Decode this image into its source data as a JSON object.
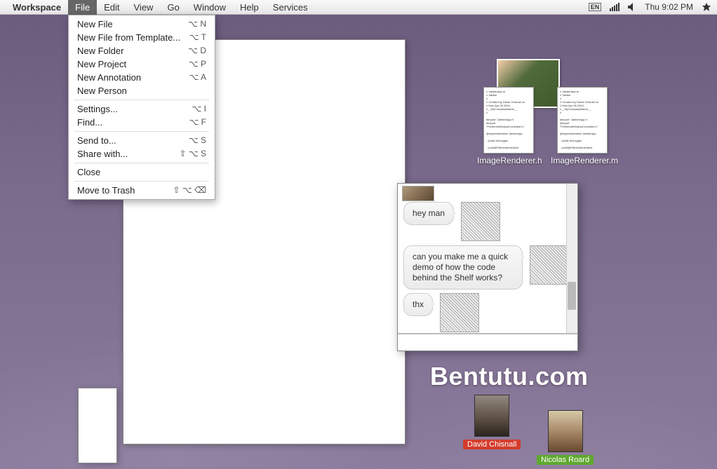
{
  "menubar": {
    "items": [
      {
        "label": "Workspace",
        "bold": true
      },
      {
        "label": "File",
        "active": true
      },
      {
        "label": "Edit"
      },
      {
        "label": "View"
      },
      {
        "label": "Go"
      },
      {
        "label": "Window"
      },
      {
        "label": "Help"
      },
      {
        "label": "Services"
      }
    ],
    "right": {
      "lang": "EN",
      "clock": "Thu 9:02 PM"
    }
  },
  "file_menu": {
    "groups": [
      [
        {
          "label": "New File",
          "shortcut": "⌥ N"
        },
        {
          "label": "New File from Template...",
          "shortcut": "⌥ T"
        },
        {
          "label": "New Folder",
          "shortcut": "⌥ D"
        },
        {
          "label": "New Project",
          "shortcut": "⌥ P"
        },
        {
          "label": "New Annotation",
          "shortcut": "⌥ A"
        },
        {
          "label": "New Person",
          "shortcut": ""
        }
      ],
      [
        {
          "label": "Settings...",
          "shortcut": "⌥ I"
        },
        {
          "label": "Find...",
          "shortcut": "⌥ F"
        }
      ],
      [
        {
          "label": "Send to...",
          "shortcut": "⌥ S"
        },
        {
          "label": "Share with...",
          "shortcut": "⇧ ⌥ S"
        }
      ],
      [
        {
          "label": "Close",
          "shortcut": ""
        }
      ],
      [
        {
          "label": "Move to Trash",
          "shortcut": "⇧ ⌥ ⌫"
        }
      ]
    ]
  },
  "desktop_files": {
    "file1": "ImageRenderer.h",
    "file2": "ImageRenderer.m"
  },
  "chat": {
    "messages": [
      {
        "text": "hey man"
      },
      {
        "text": "can you make me a quick demo of how the code behind the Shelf works?"
      },
      {
        "text": "thx"
      }
    ]
  },
  "watermark": "Bentutu.com",
  "contacts": {
    "a": "David Chisnall",
    "b": "Nicolas Roard"
  }
}
